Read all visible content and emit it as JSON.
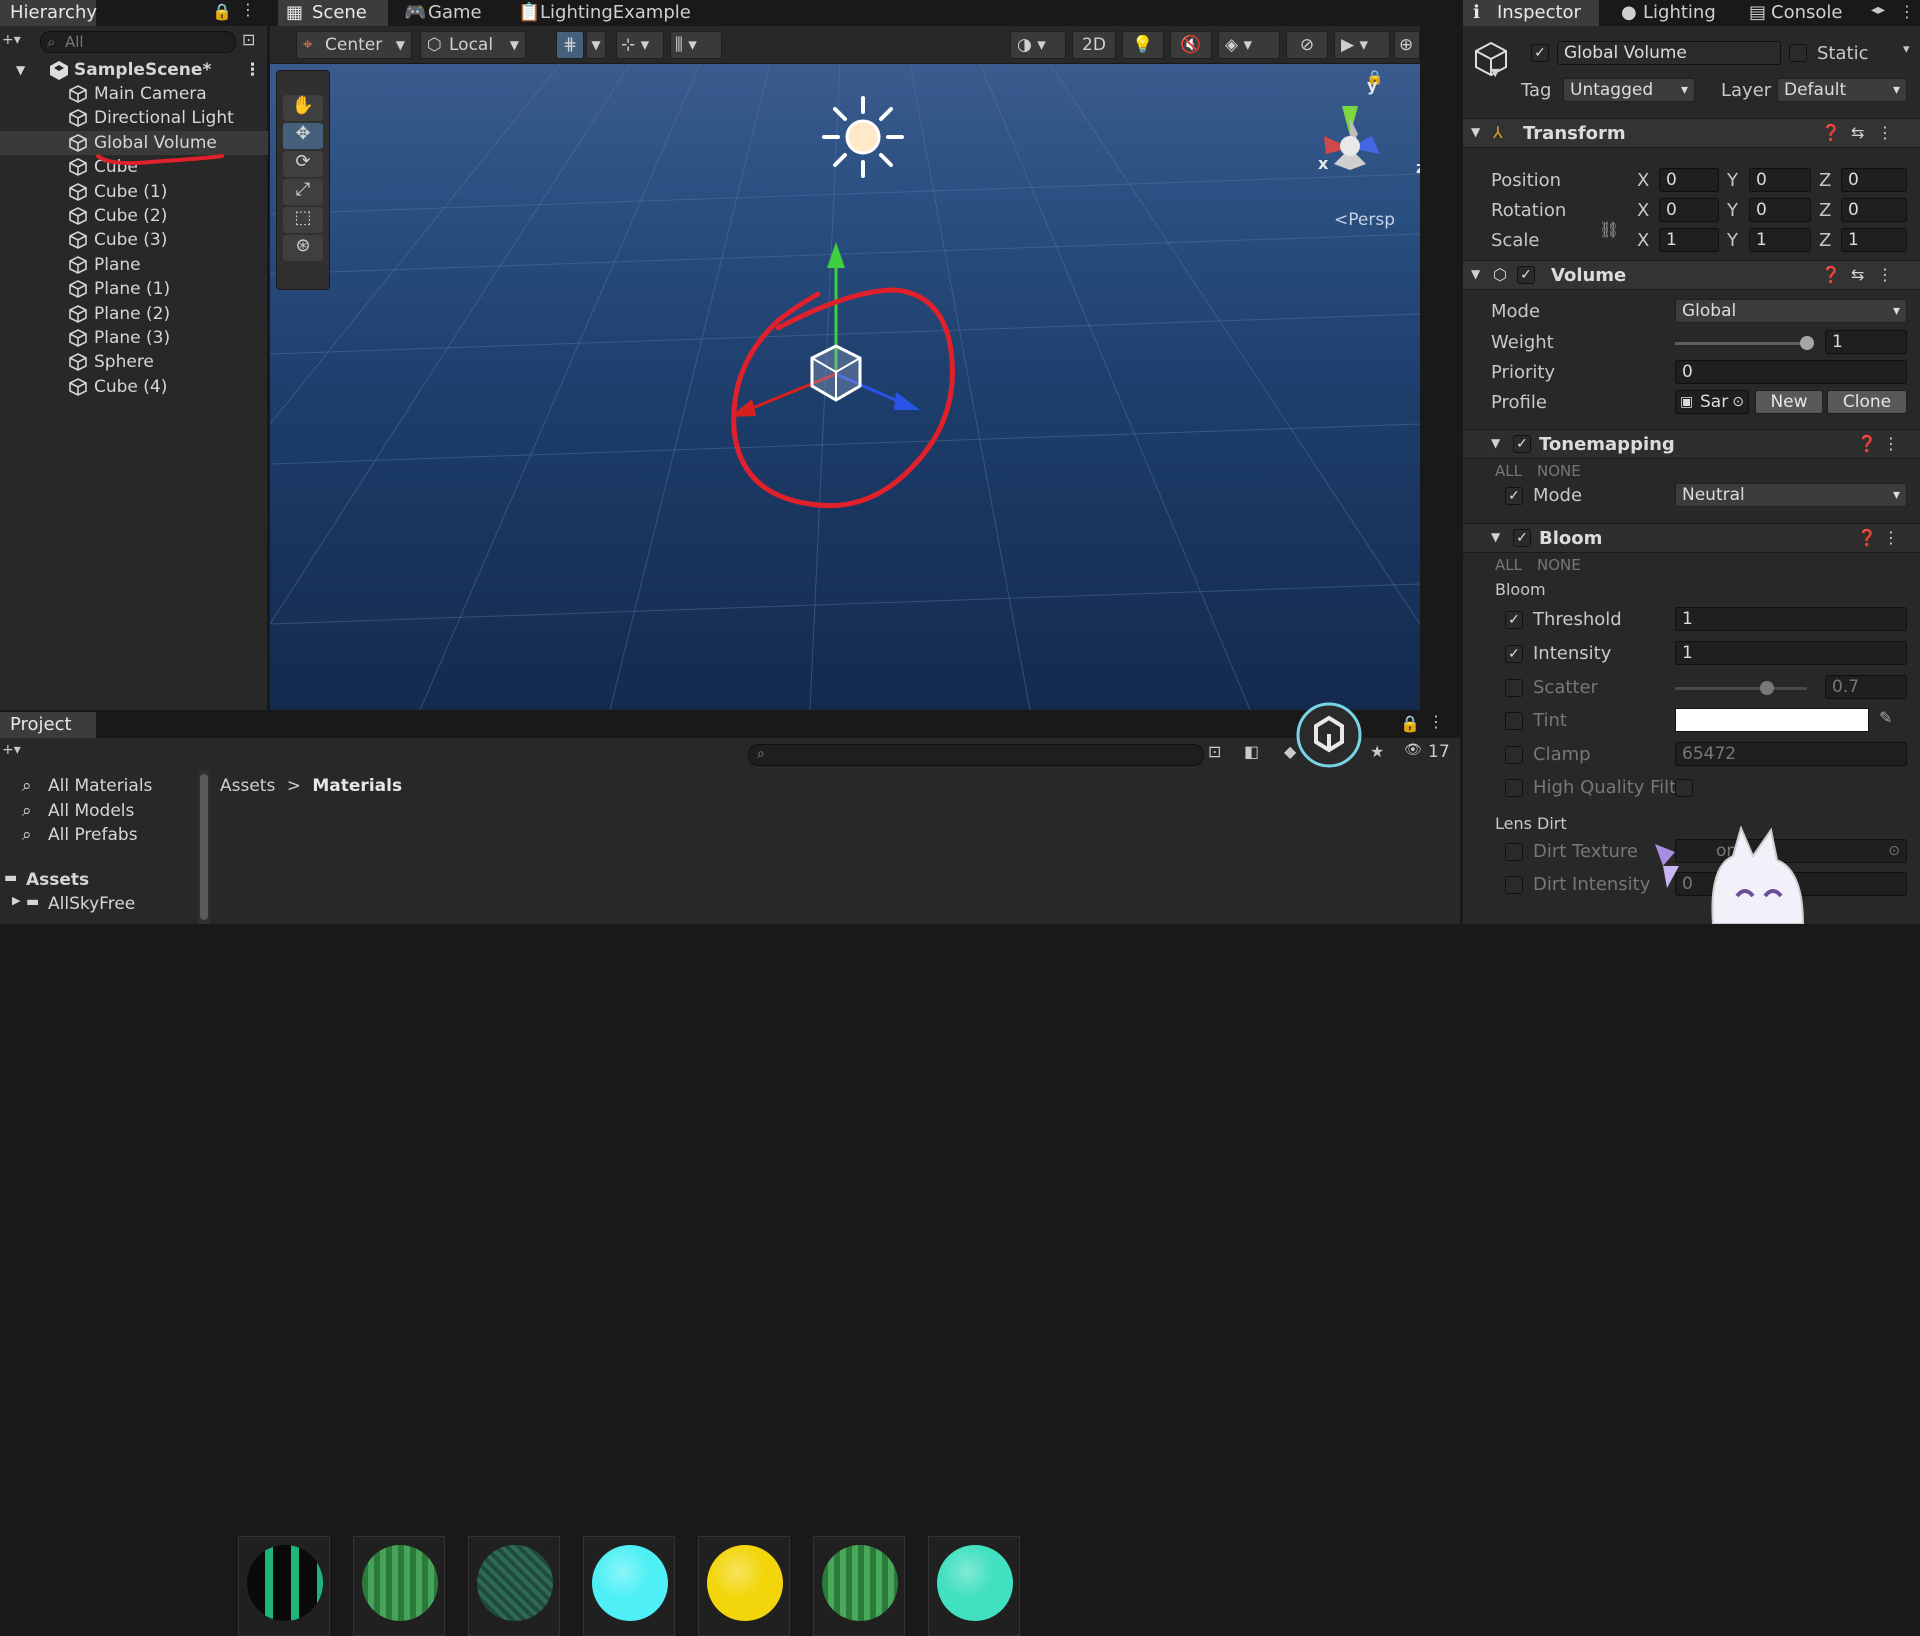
{
  "hierarchy": {
    "tab": "Hierarchy",
    "search_placeholder": "All",
    "scene": "SampleScene*",
    "items": [
      "Main Camera",
      "Directional Light",
      "Global Volume",
      "Cube",
      "Cube (1)",
      "Cube (2)",
      "Cube (3)",
      "Plane",
      "Plane (1)",
      "Plane (2)",
      "Plane (3)",
      "Sphere",
      "Cube (4)"
    ]
  },
  "scene_tabs": [
    "Scene",
    "Game",
    "LightingExample"
  ],
  "scene_toolbar": {
    "pivot": "Center",
    "space": "Local",
    "mode2d": "2D"
  },
  "scene_view": {
    "persp_label": "<Persp",
    "axis_x": "x",
    "axis_y": "y",
    "axis_z": "z"
  },
  "inspector": {
    "tabs": [
      "Inspector",
      "Lighting",
      "Console"
    ],
    "object_name": "Global Volume",
    "static_label": "Static",
    "tag_label": "Tag",
    "tag_value": "Untagged",
    "layer_label": "Layer",
    "layer_value": "Default",
    "transform": {
      "title": "Transform",
      "position": {
        "label": "Position",
        "x": "0",
        "y": "0",
        "z": "0"
      },
      "rotation": {
        "label": "Rotation",
        "x": "0",
        "y": "0",
        "z": "0"
      },
      "scale": {
        "label": "Scale",
        "x": "1",
        "y": "1",
        "z": "1"
      },
      "axis_x": "X",
      "axis_y": "Y",
      "axis_z": "Z"
    },
    "volume": {
      "title": "Volume",
      "mode_label": "Mode",
      "mode_value": "Global",
      "weight_label": "Weight",
      "weight_value": "1",
      "weight_fraction": 1.0,
      "priority_label": "Priority",
      "priority_value": "0",
      "profile_label": "Profile",
      "profile_value": "Sar",
      "new_btn": "New",
      "clone_btn": "Clone"
    },
    "tonemapping": {
      "title": "Tonemapping",
      "all": "ALL",
      "none": "NONE",
      "mode_label": "Mode",
      "mode_value": "Neutral"
    },
    "bloom": {
      "title": "Bloom",
      "all": "ALL",
      "none": "NONE",
      "section": "Bloom",
      "threshold_label": "Threshold",
      "threshold_value": "1",
      "intensity_label": "Intensity",
      "intensity_value": "1",
      "scatter_label": "Scatter",
      "scatter_value": "0.7",
      "scatter_fraction": 0.7,
      "tint_label": "Tint",
      "tint_color": "#ffffff",
      "clamp_label": "Clamp",
      "clamp_value": "65472",
      "hq_label": "High Quality Filt",
      "lens_dirt": "Lens Dirt",
      "dirt_texture_label": "Dirt Texture",
      "dirt_texture_value": "one",
      "dirt_intensity_label": "Dirt Intensity",
      "dirt_intensity_value": "0"
    }
  },
  "project": {
    "tab": "Project",
    "count": "17",
    "favorites": [
      "All Materials",
      "All Models",
      "All Prefabs"
    ],
    "assets_root": "Assets",
    "folder": "AllSkyFree",
    "breadcrumb_root": "Assets",
    "breadcrumb_sep": ">",
    "breadcrumb_current": "Materials",
    "asset_colors": [
      "#1aa06a",
      "#2f8a45",
      "#265a48",
      "#4ff0f5",
      "#f2d60b",
      "#3a9a52",
      "#41e0c0"
    ]
  },
  "colors": {
    "accent": "#46607c",
    "annotation": "#e0202a"
  }
}
